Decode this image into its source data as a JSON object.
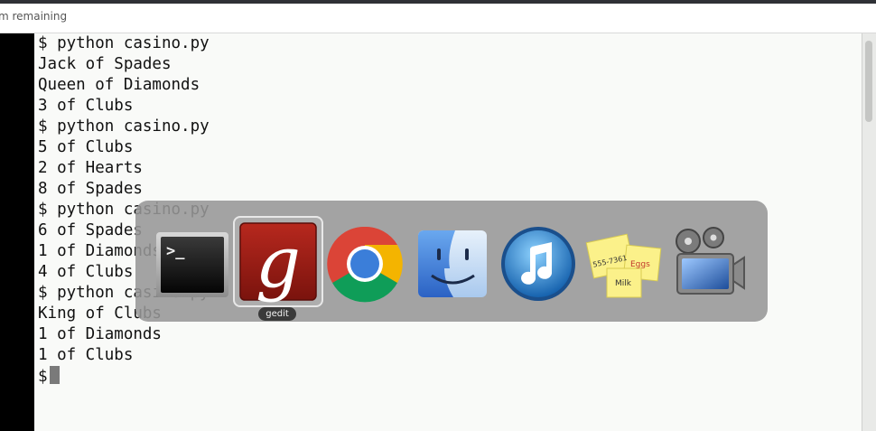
{
  "notice": {
    "text": "m remaining"
  },
  "terminal": {
    "lines": [
      "$ python casino.py",
      "Jack of Spades",
      "Queen of Diamonds",
      "3 of Clubs",
      "$ python casino.py",
      "5 of Clubs",
      "2 of Hearts",
      "8 of Spades",
      "$ python casino.py",
      "6 of Spades",
      "1 of Diamonds",
      "4 of Clubs",
      "$ python casino.py",
      "King of Clubs",
      "1 of Diamonds",
      "1 of Clubs"
    ],
    "prompt": "$"
  },
  "switcher": {
    "selected_label": "gedit",
    "apps": [
      {
        "icon": "terminal-icon",
        "prompt_glyph": ">_"
      },
      {
        "icon": "gedit-icon",
        "glyph": "g"
      },
      {
        "icon": "chrome-icon"
      },
      {
        "icon": "finder-icon"
      },
      {
        "icon": "itunes-icon"
      },
      {
        "icon": "stickies-icon",
        "note_phone": "555-7361",
        "note_eggs": "Eggs",
        "note_milk": "Milk"
      },
      {
        "icon": "movie-icon"
      }
    ]
  }
}
